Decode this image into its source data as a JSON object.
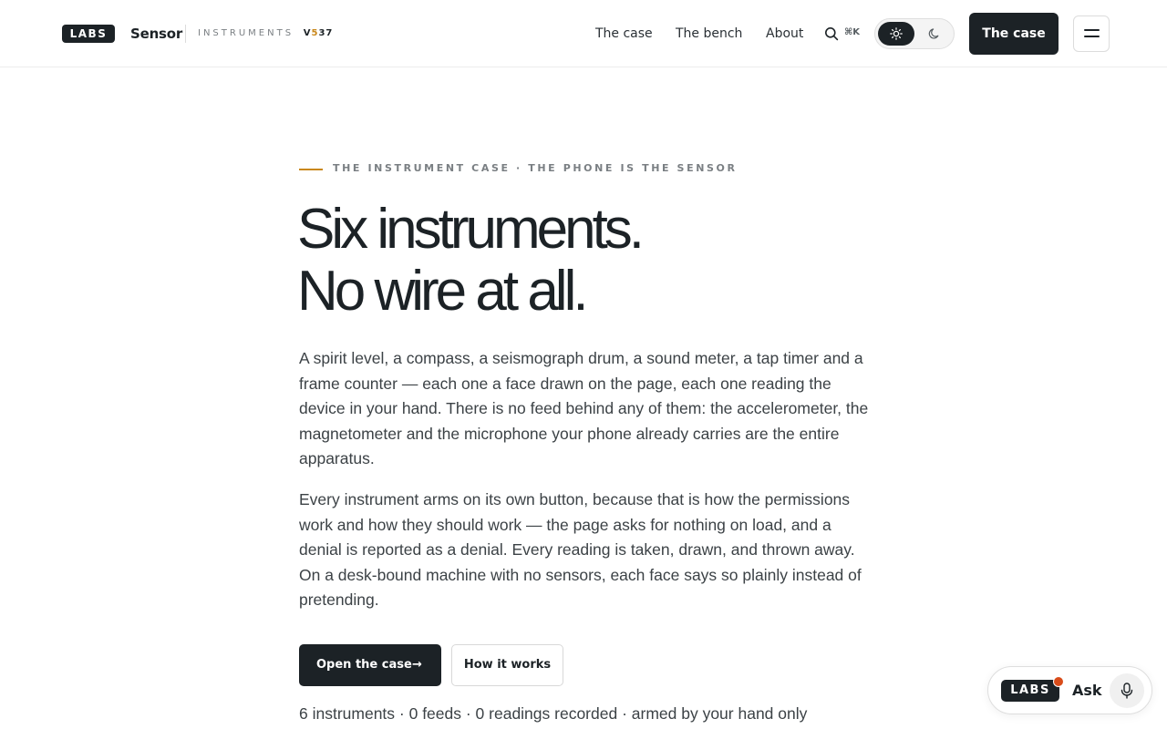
{
  "header": {
    "logo_text": "LABS",
    "brand_name": "Sensor",
    "brand_sub": "INSTRUMENTS",
    "version_prefix": "V",
    "version_highlight": "5",
    "version_rest": "37",
    "nav": [
      {
        "label": "The case"
      },
      {
        "label": "The bench"
      },
      {
        "label": "About"
      }
    ],
    "search_shortcut": "⌘K",
    "theme_options": [
      "sun-icon",
      "moon-icon"
    ],
    "cta_label": "The case",
    "menu_icon": "hamburger-icon"
  },
  "hero": {
    "eyebrow": "THE INSTRUMENT CASE · THE PHONE IS THE SENSOR",
    "headline_line1": "Six instruments.",
    "headline_line2": "No wire at all.",
    "paragraph1": "A spirit level, a compass, a seismograph drum, a sound meter, a tap timer and a frame counter — each one a face drawn on the page, each one reading the device in your hand. There is no feed behind any of them: the accelerometer, the magnetometer and the microphone your phone already carries are the entire apparatus.",
    "paragraph2": "Every instrument arms on its own button, because that is how the permissions work and how they should work — the page asks for nothing on load, and a denial is reported as a denial. Every reading is taken, drawn, and thrown away. On a desk-bound machine with no sensors, each face says so plainly instead of pretending.",
    "primary_button": "Open the case",
    "primary_arrow": "→",
    "secondary_button": "How it works",
    "stats": "6 instruments · 0 feeds · 0 readings recorded · armed by your hand only"
  },
  "ask_widget": {
    "logo_text": "LABS",
    "label": "Ask",
    "icon": "microphone-icon"
  },
  "colors": {
    "ink": "#1c2226",
    "accent": "#c9871a",
    "notification": "#d94c1a"
  }
}
